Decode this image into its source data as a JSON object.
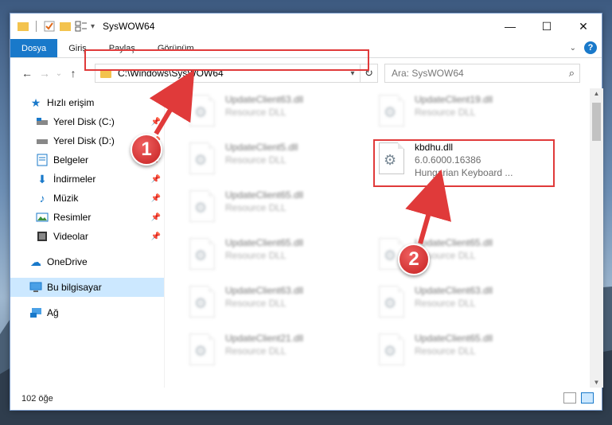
{
  "window": {
    "title": "SysWOW64"
  },
  "window_controls": {
    "minimize": "—",
    "maximize": "☐",
    "close": "✕"
  },
  "ribbon": {
    "tabs": [
      "Dosya",
      "Giriş",
      "Paylaş",
      "Görünüm"
    ],
    "help": "?"
  },
  "navigation": {
    "back": "←",
    "forward": "→",
    "recent": "⌄",
    "up": "↑",
    "address": "C:\\Windows\\SysWOW64",
    "search_placeholder": "Ara: SysWOW64"
  },
  "sidebar": {
    "quick_access": "Hızlı erişim",
    "items": [
      {
        "label": "Yerel Disk (C:)",
        "pinned": true
      },
      {
        "label": "Yerel Disk (D:)",
        "pinned": true
      },
      {
        "label": "Belgeler",
        "pinned": true
      },
      {
        "label": "İndirmeler",
        "pinned": true
      },
      {
        "label": "Müzik",
        "pinned": true
      },
      {
        "label": "Resimler",
        "pinned": true
      },
      {
        "label": "Videolar",
        "pinned": true
      }
    ],
    "onedrive": "OneDrive",
    "this_pc": "Bu bilgisayar",
    "network": "Ağ"
  },
  "files": {
    "left_column": [
      {
        "name": "UpdateClient63.dll",
        "type": "Resource DLL"
      },
      {
        "name": "UpdateClient5.dll",
        "type": "Resource DLL"
      },
      {
        "name": "UpdateClient65.dll",
        "type": "Resource DLL"
      },
      {
        "name": "UpdateClient65.dll",
        "type": "Resource DLL"
      },
      {
        "name": "UpdateClient63.dll",
        "type": "Resource DLL"
      },
      {
        "name": "UpdateClient21.dll",
        "type": "Resource DLL"
      }
    ],
    "right_column": [
      {
        "name": "UpdateClient19.dll",
        "type": "Resource DLL"
      },
      {
        "name": "UpdateClient65.dll",
        "type": "Resource DLL"
      },
      {
        "name": "UpdateClient63.dll",
        "type": "Resource DLL"
      },
      {
        "name": "UpdateClient65.dll",
        "type": "Resource DLL"
      }
    ],
    "selected": {
      "name": "kbdhu.dll",
      "version": "6.0.6000.16386",
      "description": "Hungarian Keyboard ..."
    }
  },
  "status": {
    "item_count": "102 öğe"
  },
  "annotations": {
    "step1": "1",
    "step2": "2",
    "color": "#e03a3a"
  }
}
